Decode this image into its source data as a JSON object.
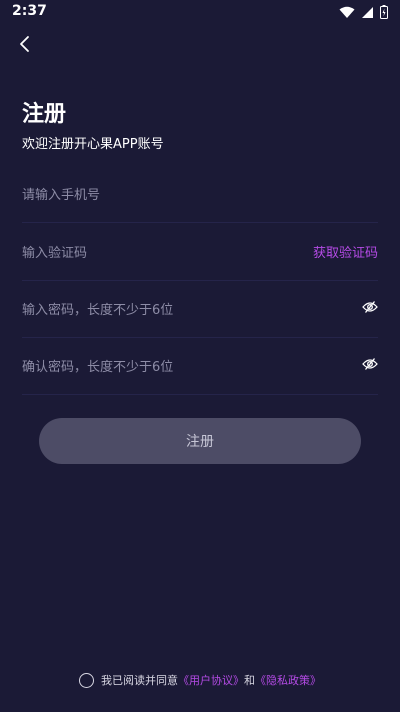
{
  "status_bar": {
    "time": "2:37"
  },
  "header": {
    "title": "注册",
    "subtitle": "欢迎注册开心果APP账号"
  },
  "form": {
    "phone_placeholder": "请输入手机号",
    "code_placeholder": "输入验证码",
    "get_code_label": "获取验证码",
    "password_placeholder": "输入密码，长度不少于6位",
    "confirm_placeholder": "确认密码，长度不少于6位"
  },
  "submit_label": "注册",
  "agreement": {
    "prefix": "我已阅读并同意",
    "user_agreement": "《用户协议》",
    "and": "和",
    "privacy_policy": "《隐私政策》"
  },
  "colors": {
    "background": "#1b1a36",
    "accent": "#b54be6",
    "button": "#4d4c66"
  },
  "icons": [
    "back-arrow-icon",
    "wifi-icon",
    "signal-icon",
    "battery-icon",
    "eye-hidden-icon",
    "checkbox-circle-icon"
  ]
}
